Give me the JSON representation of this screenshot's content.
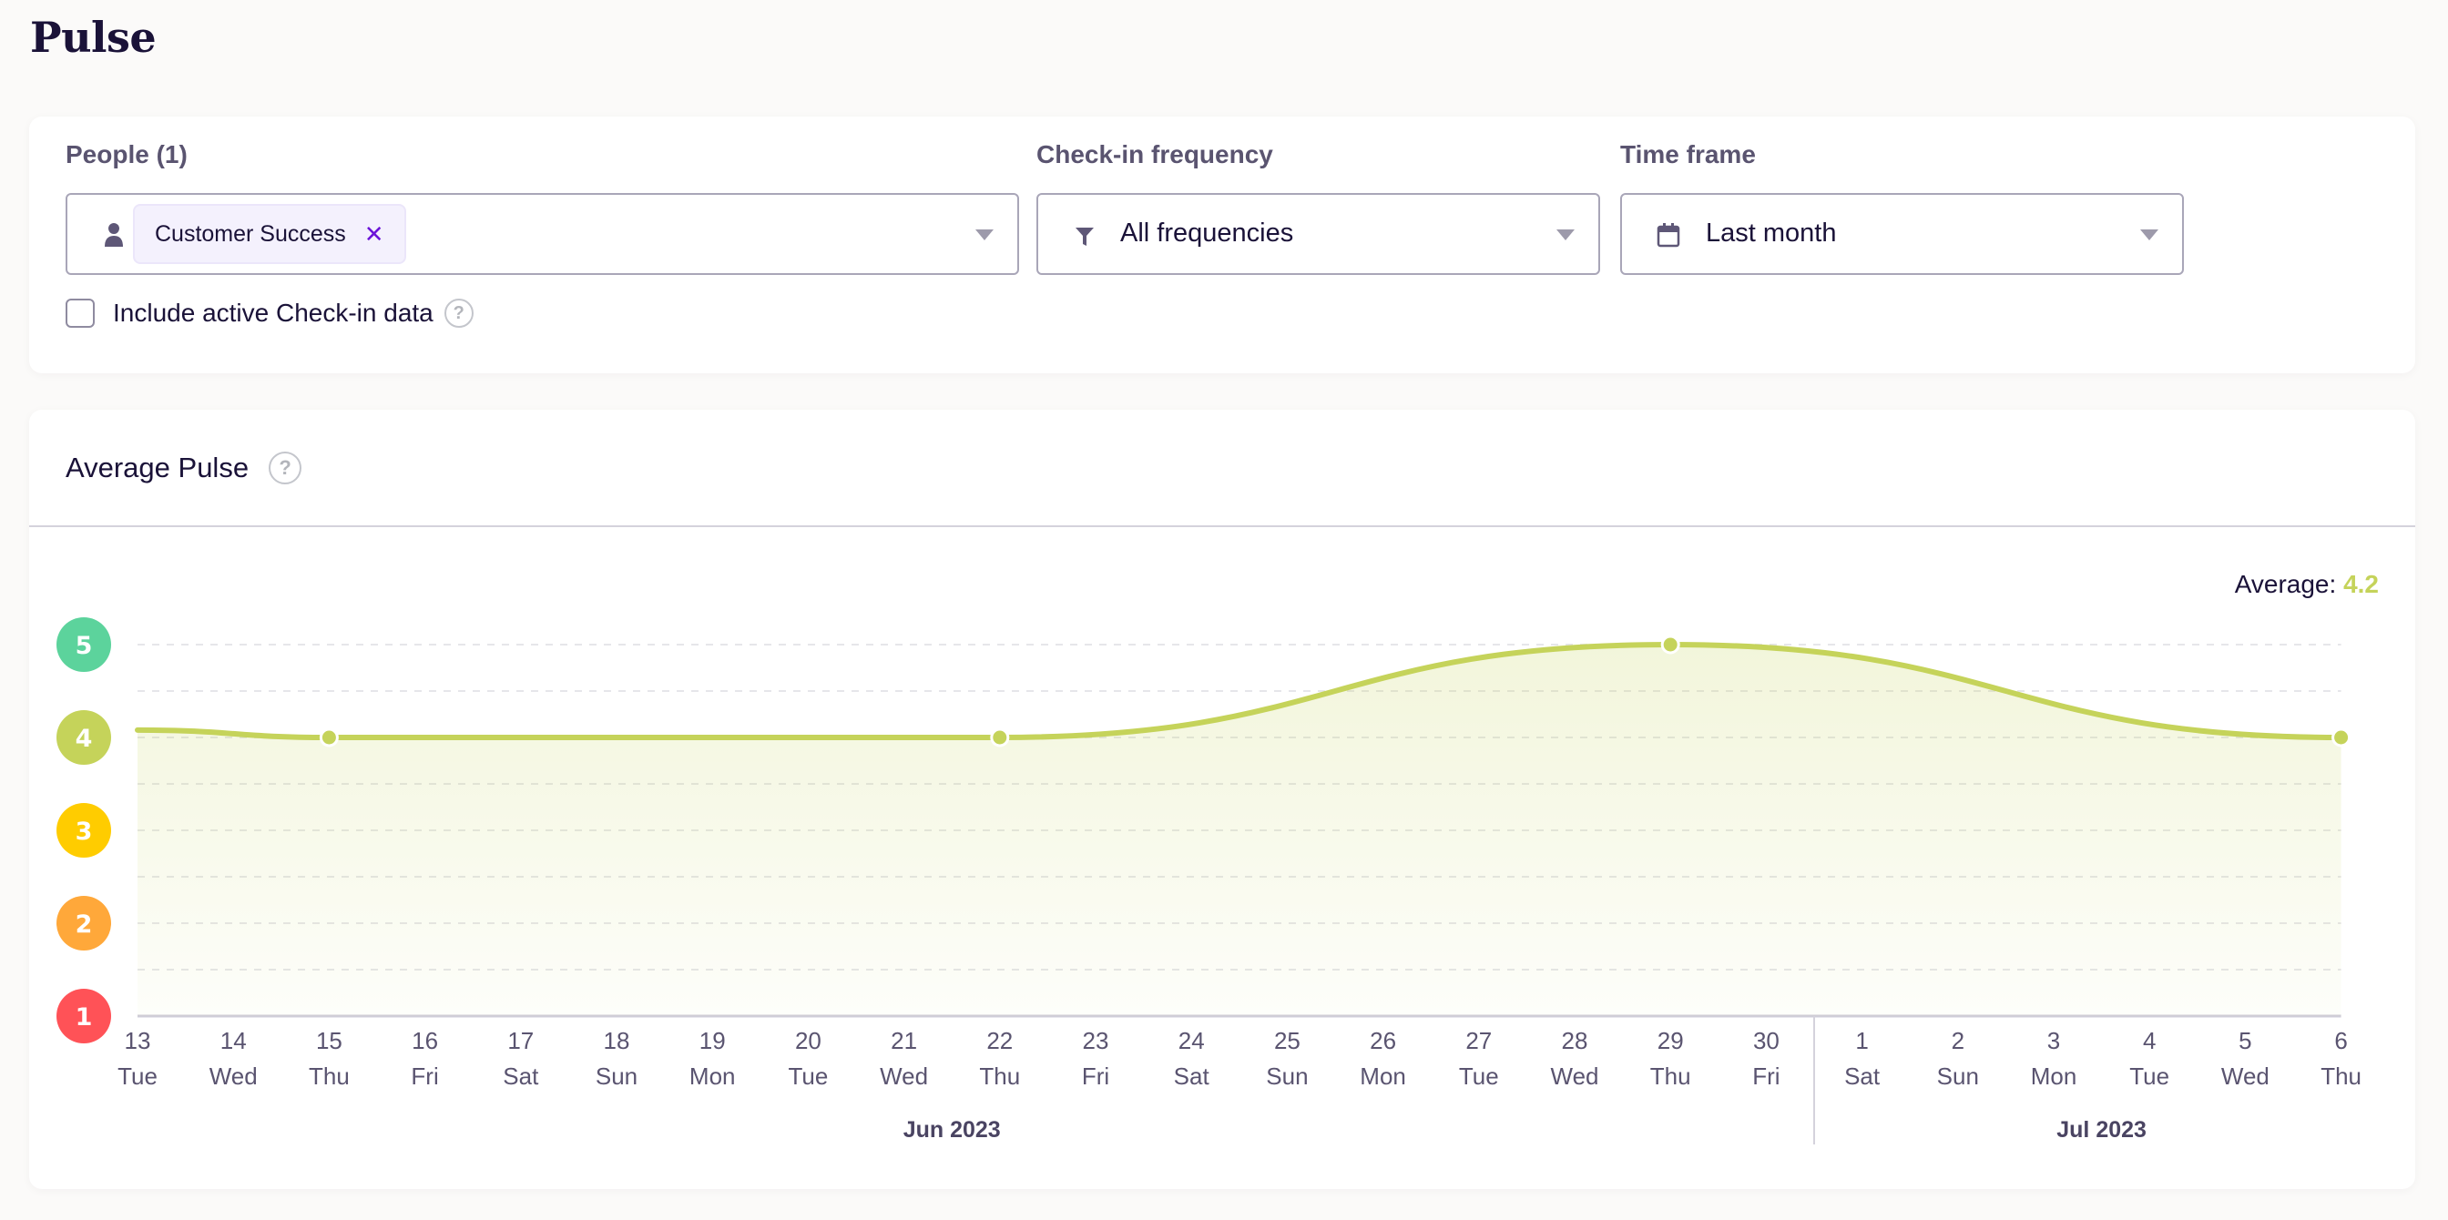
{
  "page": {
    "title": "Pulse"
  },
  "filters": {
    "people": {
      "label": "People (1)",
      "icon": "person-icon",
      "chips": [
        {
          "label": "Customer Success",
          "remove_icon": "close-icon",
          "remove_glyph": "✕"
        }
      ]
    },
    "frequency": {
      "label": "Check-in frequency",
      "icon": "filter-icon",
      "value": "All frequencies"
    },
    "timeframe": {
      "label": "Time frame",
      "icon": "calendar-icon",
      "value": "Last month"
    },
    "include_active": {
      "label": "Include active Check-in data",
      "checked": false,
      "help_glyph": "?"
    }
  },
  "chart_card": {
    "title": "Average Pulse",
    "help_glyph": "?",
    "average_label": "Average:",
    "average_value": "4.2"
  },
  "colors": {
    "line": "#c5d35a",
    "level_5": "#5cd39c",
    "level_4": "#c5d35a",
    "level_3": "#ffcc00",
    "level_2": "#ffa83a",
    "level_1": "#ff5257",
    "chip_remove": "#6b14d8"
  },
  "chart_data": {
    "type": "area",
    "title": "Average Pulse",
    "xlabel": "",
    "ylabel": "",
    "ylim": [
      1,
      5
    ],
    "y_ticks": [
      1,
      2,
      3,
      4,
      5
    ],
    "grid": "dashed every 0.5",
    "x": [
      {
        "day": "13",
        "weekday": "Tue"
      },
      {
        "day": "14",
        "weekday": "Wed"
      },
      {
        "day": "15",
        "weekday": "Thu"
      },
      {
        "day": "16",
        "weekday": "Fri"
      },
      {
        "day": "17",
        "weekday": "Sat"
      },
      {
        "day": "18",
        "weekday": "Sun"
      },
      {
        "day": "19",
        "weekday": "Mon"
      },
      {
        "day": "20",
        "weekday": "Tue"
      },
      {
        "day": "21",
        "weekday": "Wed"
      },
      {
        "day": "22",
        "weekday": "Thu"
      },
      {
        "day": "23",
        "weekday": "Fri"
      },
      {
        "day": "24",
        "weekday": "Sat"
      },
      {
        "day": "25",
        "weekday": "Sun"
      },
      {
        "day": "26",
        "weekday": "Mon"
      },
      {
        "day": "27",
        "weekday": "Tue"
      },
      {
        "day": "28",
        "weekday": "Wed"
      },
      {
        "day": "29",
        "weekday": "Thu"
      },
      {
        "day": "30",
        "weekday": "Fri"
      },
      {
        "day": "1",
        "weekday": "Sat"
      },
      {
        "day": "2",
        "weekday": "Sun"
      },
      {
        "day": "3",
        "weekday": "Mon"
      },
      {
        "day": "4",
        "weekday": "Tue"
      },
      {
        "day": "5",
        "weekday": "Wed"
      },
      {
        "day": "6",
        "weekday": "Thu"
      }
    ],
    "months": [
      {
        "label": "Jun 2023",
        "start_index": 0,
        "end_index": 17
      },
      {
        "label": "Jul 2023",
        "start_index": 18,
        "end_index": 23
      }
    ],
    "series": [
      {
        "name": "Average Pulse",
        "start_value": 4.08,
        "points": [
          {
            "x_index": 2,
            "label": "Jun 15",
            "value": 4
          },
          {
            "x_index": 9,
            "label": "Jun 22",
            "value": 4
          },
          {
            "x_index": 16,
            "label": "Jun 29",
            "value": 5
          },
          {
            "x_index": 23,
            "label": "Jul 6",
            "value": 4
          }
        ]
      }
    ],
    "average": 4.2
  }
}
